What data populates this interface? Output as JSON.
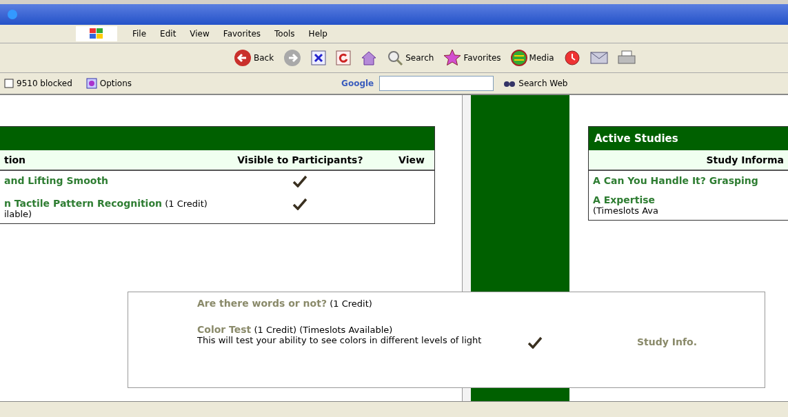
{
  "menu": [
    "File",
    "Edit",
    "View",
    "Favorites",
    "Tools",
    "Help"
  ],
  "toolbar": [
    {
      "kind": "back",
      "label": "Back"
    },
    {
      "kind": "forward"
    },
    {
      "kind": "stop"
    },
    {
      "kind": "refresh"
    },
    {
      "kind": "home"
    },
    {
      "kind": "search",
      "label": "Search"
    },
    {
      "kind": "favorites",
      "label": "Favorites"
    },
    {
      "kind": "media",
      "label": "Media"
    },
    {
      "kind": "history"
    },
    {
      "kind": "mail"
    },
    {
      "kind": "print"
    }
  ],
  "links_bar": {
    "blocked": "9510 blocked",
    "options": "Options",
    "google": "Google",
    "search_button": "Search Web"
  },
  "left_table": {
    "columns": [
      "tion",
      "Visible to Participants?",
      "View"
    ],
    "rows": [
      {
        "title": "and Lifting Smooth",
        "visible": true
      },
      {
        "title": "n Tactile Pattern Recognition",
        "credit": "(1 Credit)",
        "note": "ilable)",
        "visible": true
      }
    ]
  },
  "right_table": {
    "title": "Active Studies",
    "columns": [
      "Study Informa"
    ],
    "rows": [
      {
        "title": "A Can You Handle It? Grasping"
      },
      {
        "title": "A Expertise",
        "note": "(Timeslots Ava"
      }
    ]
  },
  "front_table": {
    "rows": [
      {
        "title": "Are there words or not?",
        "credit": "(1 Credit)",
        "visible": false
      },
      {
        "title": "Color Test",
        "credit": "(1 Credit) (Timeslots Available)",
        "description": "This will test your ability to see colors in different levels of light",
        "visible": true,
        "view": "Study Info."
      }
    ]
  }
}
